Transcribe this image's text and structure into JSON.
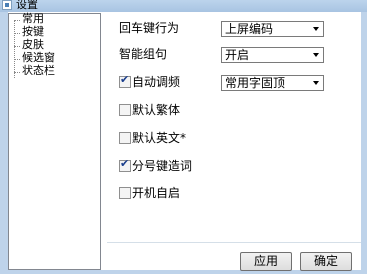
{
  "window": {
    "title": "设置"
  },
  "nav": {
    "items": [
      "常用",
      "按键",
      "皮肤",
      "候选窗",
      "状态栏"
    ]
  },
  "settings": {
    "enter_key": {
      "label": "回车键行为",
      "value": "上屏编码"
    },
    "smart_phrase": {
      "label": "智能组句",
      "value": "开启"
    },
    "auto_freq": {
      "label": "自动调频",
      "checked": true,
      "value": "常用字固顶"
    },
    "default_traditional": {
      "label": "默认繁体",
      "checked": false
    },
    "default_english": {
      "label": "默认英文*",
      "checked": false
    },
    "semicolon_word": {
      "label": "分号键造词",
      "checked": true
    },
    "startup": {
      "label": "开机自启",
      "checked": false
    }
  },
  "buttons": {
    "apply": "应用",
    "ok": "确定"
  },
  "icons": {
    "check": "check-icon",
    "dropdown": "chevron-down-icon"
  },
  "colors": {
    "frame": "#bed3ea",
    "check": "#1a3e8c"
  }
}
